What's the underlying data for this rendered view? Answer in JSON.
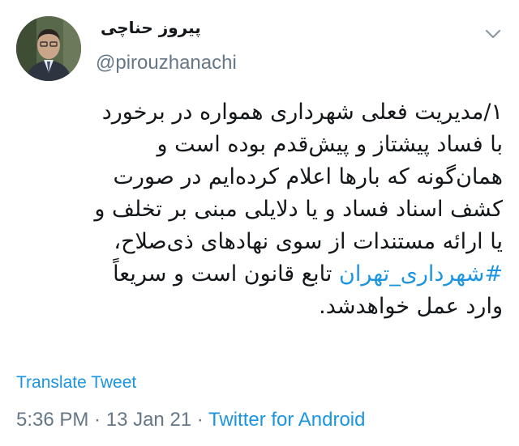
{
  "author": {
    "display_name": "پیروز حناچی",
    "handle": "@pirouzhanachi"
  },
  "icons": {
    "avatar": "profile-photo",
    "menu": "chevron-down-icon"
  },
  "tweet": {
    "lines": [
      "۱/مدیریت فعلی شهرداری همواره در برخورد",
      "با فساد پیشتاز و پیش‌قدم بوده است و",
      "همان‌گونه که بارها اعلام کرده‌ایم در صورت",
      "کشف اسناد فساد و یا دلایلی مبنی بر تخلف و",
      "یا ارائه مستندات از سوی نهادهای ذی‌صلاح،"
    ],
    "hashtag": "#شهرداری_تهران",
    "line6_rest": " تابع قانون است و سریعاً",
    "line7": "وارد عمل خواهدشد."
  },
  "translate_label": "Translate Tweet",
  "meta": {
    "time": "5:36 PM",
    "separator1": " · ",
    "date": "13 Jan 21",
    "separator2": " · ",
    "source": "Twitter for Android"
  },
  "colors": {
    "link": "#1b95e0",
    "secondary": "#657786",
    "text": "#14171a"
  }
}
